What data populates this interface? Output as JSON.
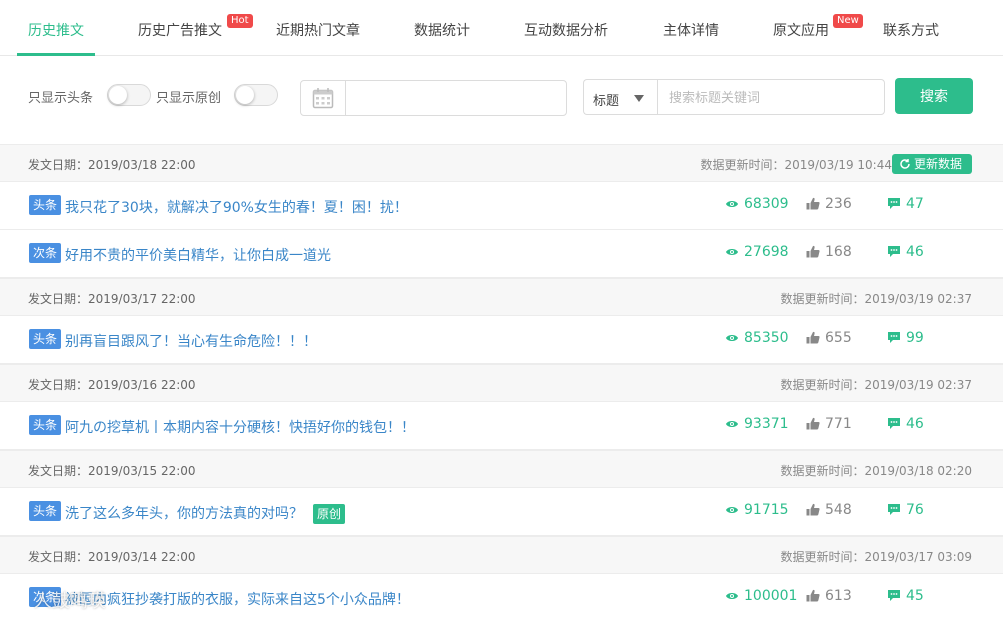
{
  "tabs": [
    {
      "label": "历史推文",
      "active": true
    },
    {
      "label": "历史广告推文",
      "badge": "Hot"
    },
    {
      "label": "近期热门文章"
    },
    {
      "label": "数据统计"
    },
    {
      "label": "互动数据分析"
    },
    {
      "label": "主体详情"
    },
    {
      "label": "原文应用",
      "badge": "New"
    },
    {
      "label": "联系方式"
    }
  ],
  "filter": {
    "only_headline": "只显示头条",
    "only_original": "只显示原创",
    "date_value": "",
    "select_value": "标题",
    "search_placeholder": "搜索标题关键词",
    "search_button": "搜索"
  },
  "groups": [
    {
      "pub": "发文日期：2019/03/18 22:00",
      "updated": "数据更新时间：2019/03/19 10:44",
      "refresh_label": "更新数据",
      "articles": [
        {
          "tag": "头条",
          "title": "我只花了30块，就解决了90%女生的春！夏！困！扰！",
          "reads": "68309",
          "likes": "236",
          "comments": "47"
        },
        {
          "tag": "次条",
          "title": "好用不贵的平价美白精华，让你白成一道光",
          "reads": "27698",
          "likes": "168",
          "comments": "46"
        }
      ]
    },
    {
      "pub": "发文日期：2019/03/17 22:00",
      "updated": "数据更新时间：2019/03/19 02:37",
      "articles": [
        {
          "tag": "头条",
          "title": "别再盲目跟风了！当心有生命危险！！！",
          "reads": "85350",
          "likes": "655",
          "comments": "99"
        }
      ]
    },
    {
      "pub": "发文日期：2019/03/16 22:00",
      "updated": "数据更新时间：2019/03/19 02:37",
      "articles": [
        {
          "tag": "头条",
          "title": "阿九の挖草机丨本期内容十分硬核！快捂好你的钱包！！",
          "reads": "93371",
          "likes": "771",
          "comments": "46"
        }
      ]
    },
    {
      "pub": "发文日期：2019/03/15 22:00",
      "updated": "数据更新时间：2019/03/18 02:20",
      "articles": [
        {
          "tag": "头条",
          "title": "洗了这么多年头，你的方法真的对吗？",
          "original": "原创",
          "reads": "91715",
          "likes": "548",
          "comments": "76"
        }
      ]
    },
    {
      "pub": "发文日期：2019/03/14 22:00",
      "updated": "数据更新时间：2019/03/17 03:09",
      "articles": [
        {
          "tag": "次条",
          "title": "被国内疯狂抄袭打版的衣服，实际来自这5个小众品牌！",
          "reads": "100001",
          "likes": "613",
          "comments": "45"
        }
      ]
    }
  ],
  "watermark": "人鼓鸣瑛",
  "colors": {
    "accent": "#2dbd8c",
    "tag": "#4a90e2",
    "badge": "#f04a4a",
    "link": "#3a86c8"
  }
}
